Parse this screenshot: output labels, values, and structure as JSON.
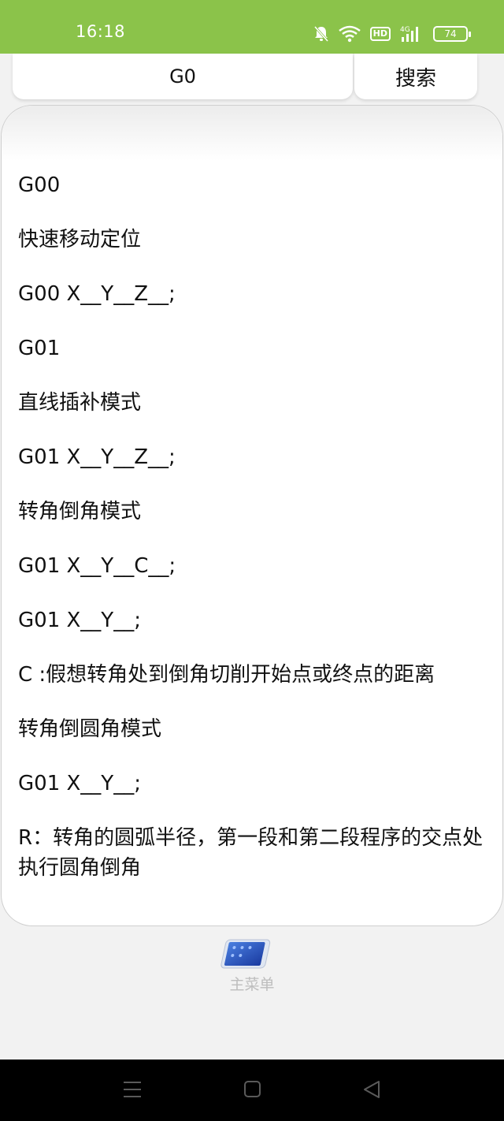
{
  "status": {
    "time": "16:18",
    "network": "4G",
    "hd": "HD",
    "battery": "74"
  },
  "search": {
    "value": "G0",
    "button_label": "搜索"
  },
  "content": {
    "lines": [
      "G00",
      "快速移动定位",
      "G00 X__Y__Z__;",
      "G01",
      "直线插补模式",
      "G01 X__Y__Z__;",
      "转角倒角模式",
      "G01 X__Y__C__;",
      "G01 X__Y__;",
      "C :假想转角处到倒角切削开始点或终点的距离",
      "转角倒圆角模式",
      "G01 X__Y__;",
      "R：转角的圆弧半径，第一段和第二段程序的交点处执行圆角倒角"
    ]
  },
  "bottom_nav": {
    "menu_label": "主菜单",
    "menu_icon": "phone-menu-icon"
  },
  "system_nav": {
    "icons": [
      "menu-lines-icon",
      "home-square-icon",
      "back-triangle-icon"
    ]
  },
  "colors": {
    "status_bar": "#8bc34a",
    "card_bg": "#ffffff",
    "page_bg": "#f2f2f2",
    "menu_label": "#bdbdbd"
  }
}
